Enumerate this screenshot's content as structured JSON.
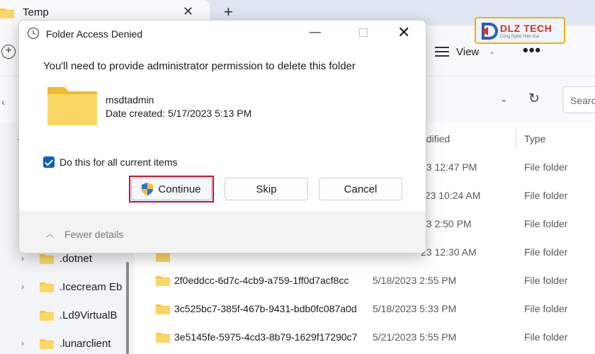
{
  "explorer": {
    "tab_title": "Temp",
    "new_tab": "+",
    "new_button": "+",
    "view_label": "View",
    "more_label": "•••",
    "search_placeholder": "Search",
    "columns": {
      "modified": "odified",
      "type": "Type"
    },
    "files": [
      {
        "name": "",
        "date": "23 12:47 PM",
        "type": "File folder"
      },
      {
        "name": "",
        "date": "023 10:24 AM",
        "type": "File folder"
      },
      {
        "name": "",
        "date": "23 2:50 PM",
        "type": "File folder"
      },
      {
        "name": "",
        "date": "23 12:30 AM",
        "type": "File folder"
      },
      {
        "name": "2f0eddcc-6d7c-4cb9-a759-1ff0d7acf8cc",
        "date": "5/18/2023 2:55 PM",
        "type": "File folder"
      },
      {
        "name": "3c525bc7-385f-467b-9431-bdb0fc087a0d",
        "date": "5/18/2023 5:33 PM",
        "type": "File folder"
      },
      {
        "name": "3e5145fe-5975-4cd3-8b79-1629f17290c7",
        "date": "5/21/2023 5:55 PM",
        "type": "File folder"
      }
    ],
    "sidebar_items": [
      {
        "label": ".dotnet"
      },
      {
        "label": ".Icecream Eb"
      },
      {
        "label": ".Ld9VirtualB"
      },
      {
        "label": ".lunarclient"
      }
    ]
  },
  "logo": {
    "text": "DLZ TECH",
    "sub": "Công Nghệ Hiện Đại"
  },
  "dialog": {
    "title": "Folder Access Denied",
    "message": "You'll need to provide administrator permission to delete this folder",
    "folder_name": "msdtadmin",
    "folder_date": "Date created: 5/17/2023 5:13 PM",
    "checkbox_label": "Do this for all current items",
    "checkbox_checked": true,
    "continue_label": "Continue",
    "skip_label": "Skip",
    "cancel_label": "Cancel",
    "fewer_details": "Fewer details"
  },
  "colors": {
    "accent": "#0f5fbf",
    "highlight": "#c8102e",
    "folder": "#f5c842"
  }
}
